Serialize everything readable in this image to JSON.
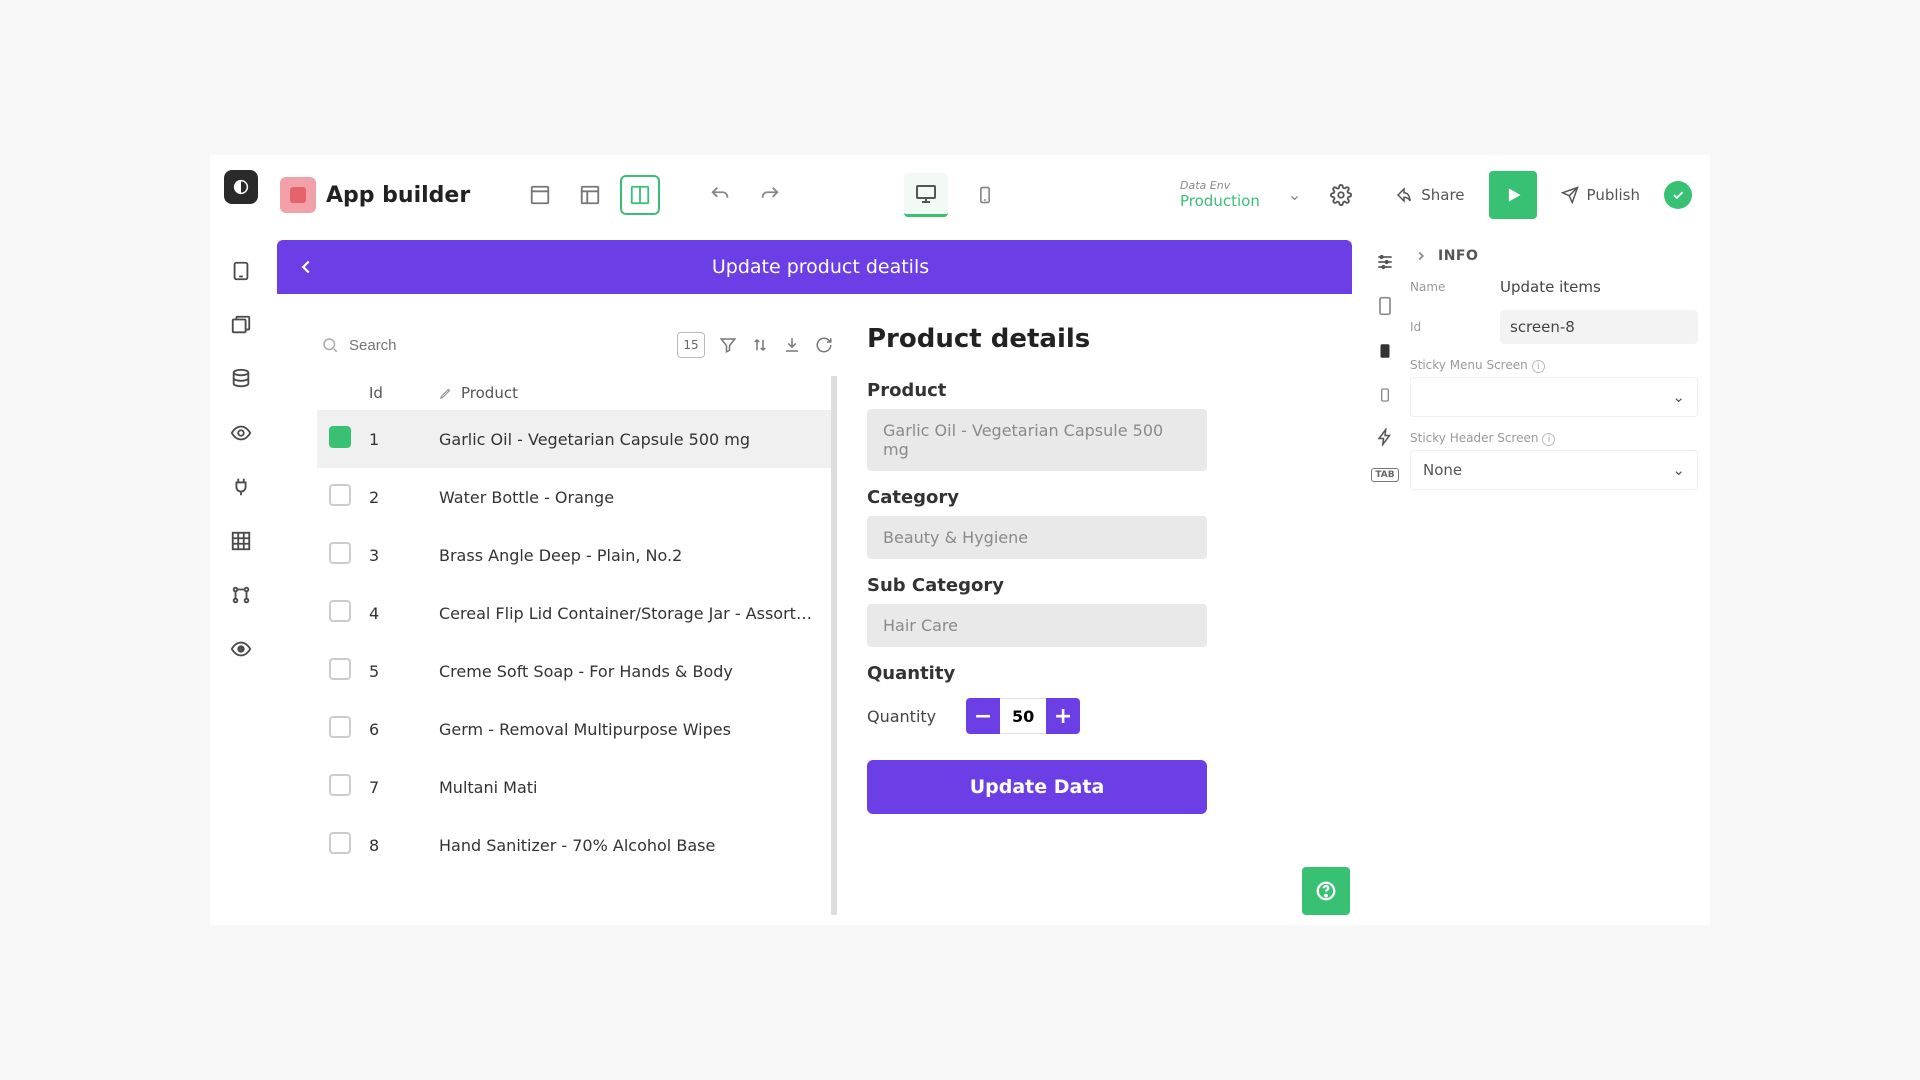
{
  "header": {
    "title": "App builder",
    "dataEnvLabel": "Data Env",
    "dataEnvValue": "Production",
    "share": "Share",
    "publish": "Publish"
  },
  "canvas": {
    "appBarTitle": "Update product deatils"
  },
  "list": {
    "searchPlaceholder": "Search",
    "pageCount": "15",
    "columns": {
      "id": "Id",
      "product": "Product"
    },
    "rows": [
      {
        "id": "1",
        "product": "Garlic Oil - Vegetarian Capsule 500 mg",
        "selected": true
      },
      {
        "id": "2",
        "product": "Water Bottle - Orange",
        "selected": false
      },
      {
        "id": "3",
        "product": "Brass Angle Deep - Plain, No.2",
        "selected": false
      },
      {
        "id": "4",
        "product": "Cereal Flip Lid Container/Storage Jar - Assorted Co",
        "selected": false
      },
      {
        "id": "5",
        "product": "Creme Soft Soap - For Hands & Body",
        "selected": false
      },
      {
        "id": "6",
        "product": "Germ - Removal Multipurpose Wipes",
        "selected": false
      },
      {
        "id": "7",
        "product": "Multani Mati",
        "selected": false
      },
      {
        "id": "8",
        "product": "Hand Sanitizer - 70% Alcohol Base",
        "selected": false
      }
    ]
  },
  "details": {
    "title": "Product details",
    "productLabel": "Product",
    "productValue": "Garlic Oil - Vegetarian Capsule 500 mg",
    "categoryLabel": "Category",
    "categoryValue": "Beauty & Hygiene",
    "subCategoryLabel": "Sub Category",
    "subCategoryValue": "Hair Care",
    "quantityHeader": "Quantity",
    "quantityLabel": "Quantity",
    "quantityValue": "50",
    "updateButton": "Update Data"
  },
  "inspector": {
    "section": "INFO",
    "nameLabel": "Name",
    "nameValue": "Update items",
    "idLabel": "Id",
    "idValue": "screen-8",
    "stickyMenuLabel": "Sticky Menu Screen",
    "stickyMenuValue": "",
    "stickyHeaderLabel": "Sticky Header Screen",
    "stickyHeaderValue": "None"
  }
}
